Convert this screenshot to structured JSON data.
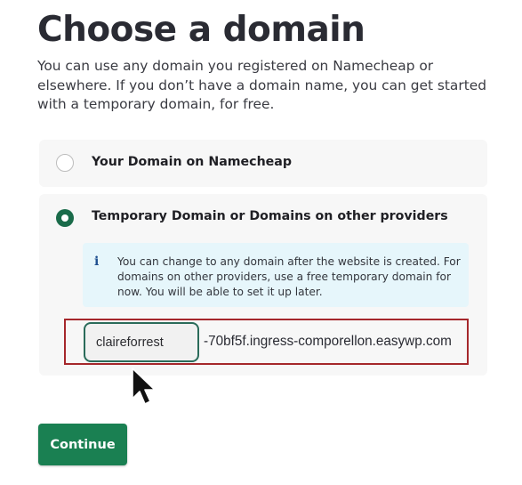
{
  "header": {
    "title": "Choose a domain",
    "description": "You can use any domain you registered on Namecheap or elsewhere. If you don’t have a domain name, you can get started with a temporary domain, for free."
  },
  "options": [
    {
      "label": "Your Domain on Namecheap",
      "selected": false
    },
    {
      "label": "Temporary Domain or Domains on other providers",
      "selected": true
    }
  ],
  "info": {
    "icon": "info-icon",
    "icon_glyph": "i",
    "text": "You can change to any domain after the website is created. For domains on other providers, use a free temporary domain for now. You will be able to set it up later."
  },
  "temp_domain": {
    "subdomain_value": "claireforrest",
    "suffix": "-70bf5f.ingress-comporellon.easywp.com"
  },
  "actions": {
    "continue_label": "Continue"
  },
  "colors": {
    "accent_green": "#1a8052",
    "radio_selected": "#1a6b4a",
    "info_bg": "#e6f6fb",
    "highlight_red": "#a5272b",
    "input_border": "#2a6b5a"
  }
}
